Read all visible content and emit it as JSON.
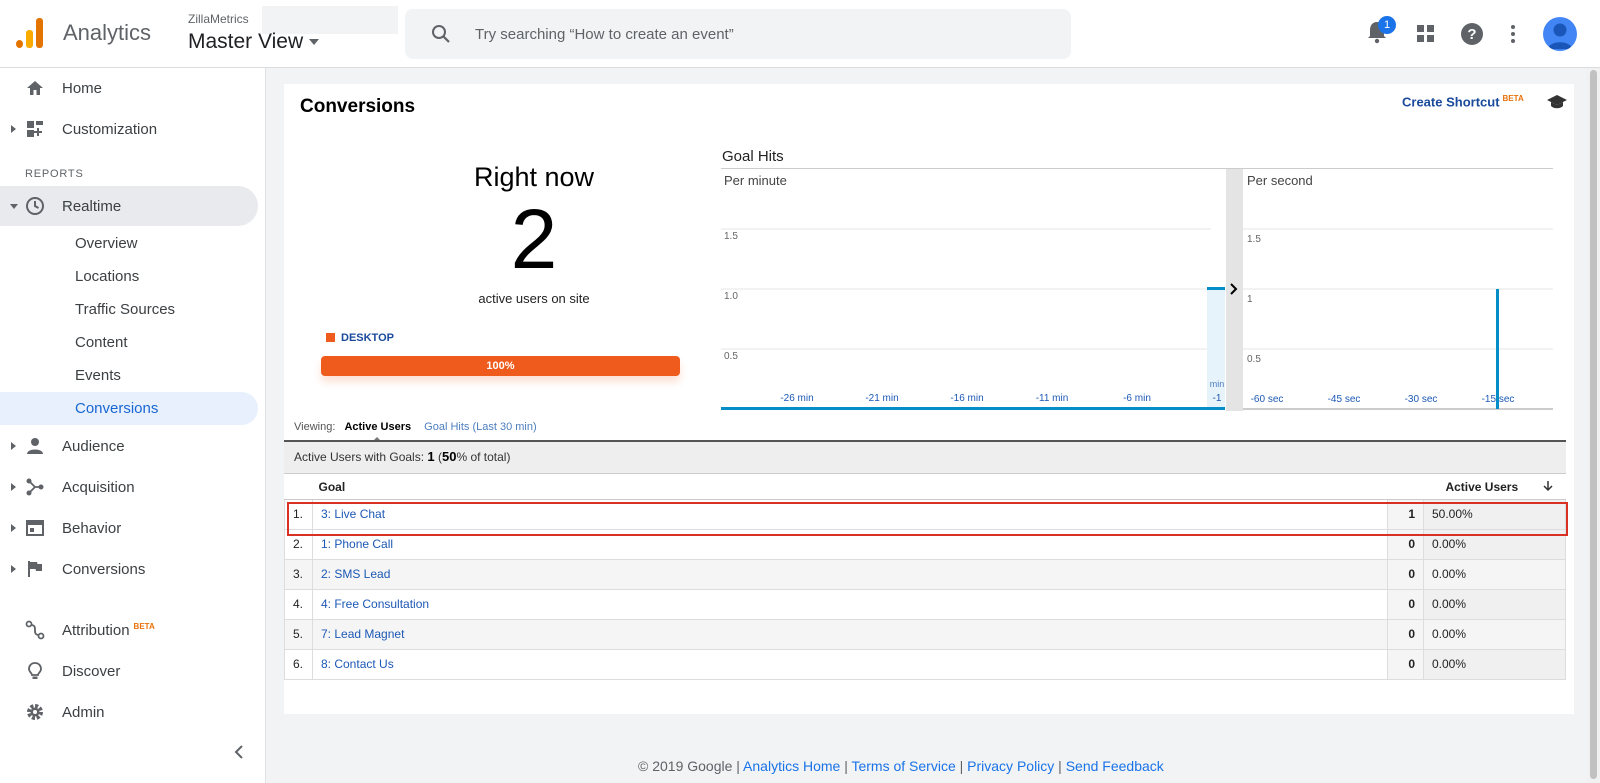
{
  "header": {
    "brand": "Analytics",
    "account": "ZillaMetrics",
    "view": "Master View",
    "search_placeholder": "Try searching “How to create an event”",
    "notification_count": "1"
  },
  "sidebar": {
    "home": "Home",
    "customization": "Customization",
    "section": "REPORTS",
    "realtime": "Realtime",
    "realtime_sub": [
      "Overview",
      "Locations",
      "Traffic Sources",
      "Content",
      "Events",
      "Conversions"
    ],
    "audience": "Audience",
    "acquisition": "Acquisition",
    "behavior": "Behavior",
    "conversions": "Conversions",
    "attribution": "Attribution",
    "attribution_beta": "BETA",
    "discover": "Discover",
    "admin": "Admin"
  },
  "card": {
    "title": "Conversions",
    "shortcut": "Create Shortcut",
    "shortcut_beta": "BETA"
  },
  "right_now": {
    "title": "Right now",
    "count": "2",
    "subtitle": "active users on site",
    "device_label": "DESKTOP",
    "device_pct": "100%",
    "device_fraction": 1.0
  },
  "goal_hits": {
    "title": "Goal Hits",
    "per_minute_label": "Per minute",
    "per_second_label": "Per second",
    "minute_ylabels": [
      "1.5",
      "1.0",
      "0.5"
    ],
    "second_ylabels": [
      "1.5",
      "1",
      "0.5"
    ],
    "minute_xlabels": [
      "-26 min",
      "-21 min",
      "-16 min",
      "-11 min",
      "-6 min"
    ],
    "minute_last_label_top": "min",
    "minute_last_label_bottom": "-1",
    "second_xlabels": [
      "-60 sec",
      "-45 sec",
      "-30 sec",
      "-15 sec"
    ]
  },
  "chart_data": [
    {
      "type": "bar",
      "title": "Per minute",
      "x": [
        -30,
        -29,
        -28,
        -27,
        -26,
        -25,
        -24,
        -23,
        -22,
        -21,
        -20,
        -19,
        -18,
        -17,
        -16,
        -15,
        -14,
        -13,
        -12,
        -11,
        -10,
        -9,
        -8,
        -7,
        -6,
        -5,
        -4,
        -3,
        -2,
        -1
      ],
      "values": [
        0,
        0,
        0,
        0,
        0,
        0,
        0,
        0,
        0,
        0,
        0,
        0,
        0,
        0,
        0,
        0,
        0,
        0,
        0,
        0,
        0,
        0,
        0,
        0,
        0,
        0,
        0,
        0,
        0,
        1
      ],
      "ylim": [
        0,
        2
      ],
      "xlabels": [
        "-26 min",
        "-21 min",
        "-16 min",
        "-11 min",
        "-6 min",
        "-1"
      ]
    },
    {
      "type": "bar",
      "title": "Per second",
      "x": [
        -60,
        -15
      ],
      "values": [
        0,
        1
      ],
      "ylim": [
        0,
        2
      ],
      "xlabels": [
        "-60 sec",
        "-45 sec",
        "-30 sec",
        "-15 sec"
      ]
    }
  ],
  "viewing": {
    "label": "Viewing:",
    "active_tab": "Active Users",
    "other_tab": "Goal Hits (Last 30 min)"
  },
  "summary": {
    "prefix": "Active Users with Goals:",
    "count": "1",
    "pct": "50",
    "suffix": "% of total)"
  },
  "table": {
    "col_goal": "Goal",
    "col_users": "Active Users",
    "rows": [
      {
        "idx": "1.",
        "goal": "3: Live Chat",
        "count": "1",
        "pct": "50.00%"
      },
      {
        "idx": "2.",
        "goal": "1: Phone Call",
        "count": "0",
        "pct": "0.00%"
      },
      {
        "idx": "3.",
        "goal": "2: SMS Lead",
        "count": "0",
        "pct": "0.00%"
      },
      {
        "idx": "4.",
        "goal": "4: Free Consultation",
        "count": "0",
        "pct": "0.00%"
      },
      {
        "idx": "5.",
        "goal": "7: Lead Magnet",
        "count": "0",
        "pct": "0.00%"
      },
      {
        "idx": "6.",
        "goal": "8: Contact Us",
        "count": "0",
        "pct": "0.00%"
      }
    ]
  },
  "footer": {
    "copyright": "© 2019 Google",
    "links": [
      "Analytics Home",
      "Terms of Service",
      "Privacy Policy",
      "Send Feedback"
    ]
  },
  "colors": {
    "accent": "#1a73e8",
    "device": "#ee5b1c",
    "chart": "#058dc7",
    "highlight": "#d93025"
  }
}
